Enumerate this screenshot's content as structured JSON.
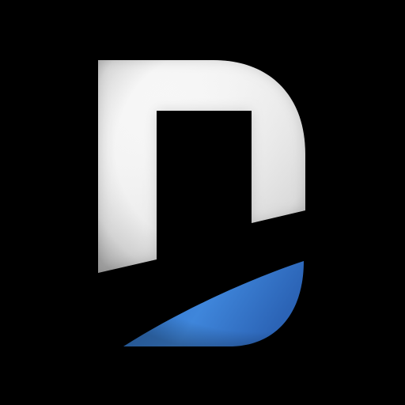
{
  "app_icon": {
    "icon_name": "letter-d-logo-icon",
    "colors": {
      "background": "#000000",
      "letter_light": "#ffffff",
      "letter_shadow": "#bdbdbd",
      "accent_light": "#4a8fe0",
      "accent_dark": "#1f5fb0"
    }
  }
}
